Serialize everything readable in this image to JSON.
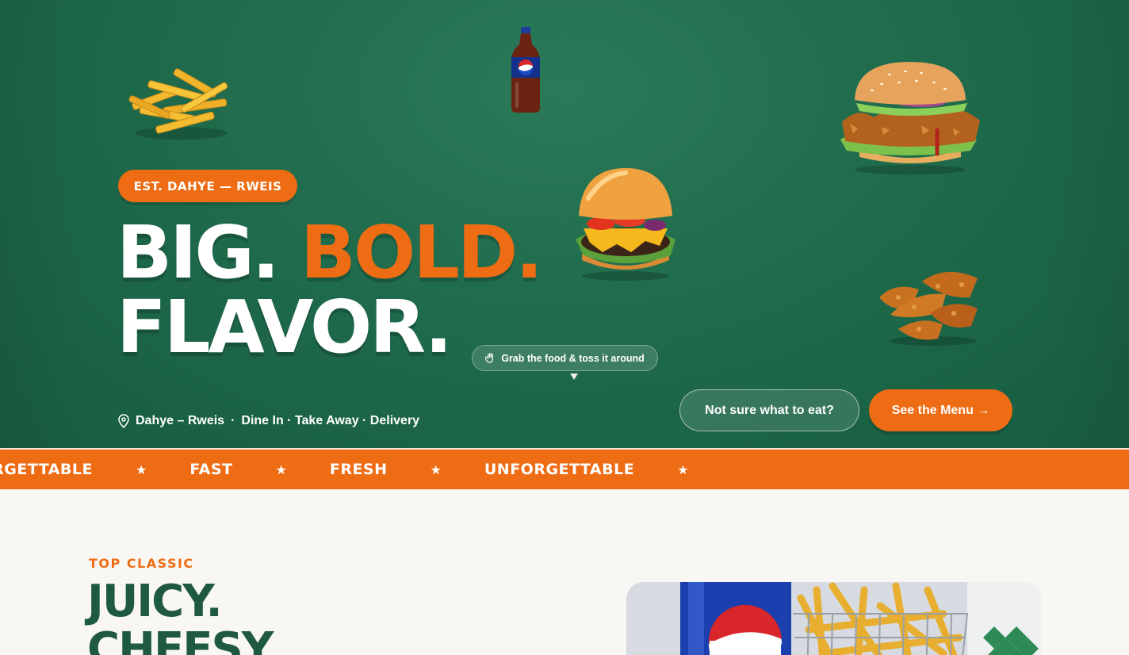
{
  "hero": {
    "badge": "EST. DAHYE — RWEIS",
    "headline_line1_white": "BIG.",
    "headline_line1_orange": "BOLD.",
    "headline_line2": "FLAVOR.",
    "location_text": "Dahye – Rweis",
    "services_text": "Dine In · Take Away · Delivery",
    "separator": "·",
    "tooltip": "Grab the food & toss it around",
    "btn_secondary": "Not sure what to eat?",
    "btn_primary": "See the Menu →"
  },
  "food_items": [
    "fries-icon",
    "pepsi-bottle-icon",
    "cheeseburger-icon",
    "chicken-burger-icon",
    "chicken-tenders-icon"
  ],
  "marquee": {
    "words": [
      "FORGETTABLE",
      "FAST",
      "FRESH",
      "UNFORGETTABLE"
    ],
    "separator": "★"
  },
  "section": {
    "eyebrow": "TOP CLASSIC",
    "title_line1": "JUICY.",
    "title_line2": "CHEESY."
  },
  "colors": {
    "brand_green": "#1f6b4c",
    "brand_orange": "#ee6c14",
    "dark_green_text": "#1f5a40",
    "page_bg": "#f8f7f4"
  }
}
